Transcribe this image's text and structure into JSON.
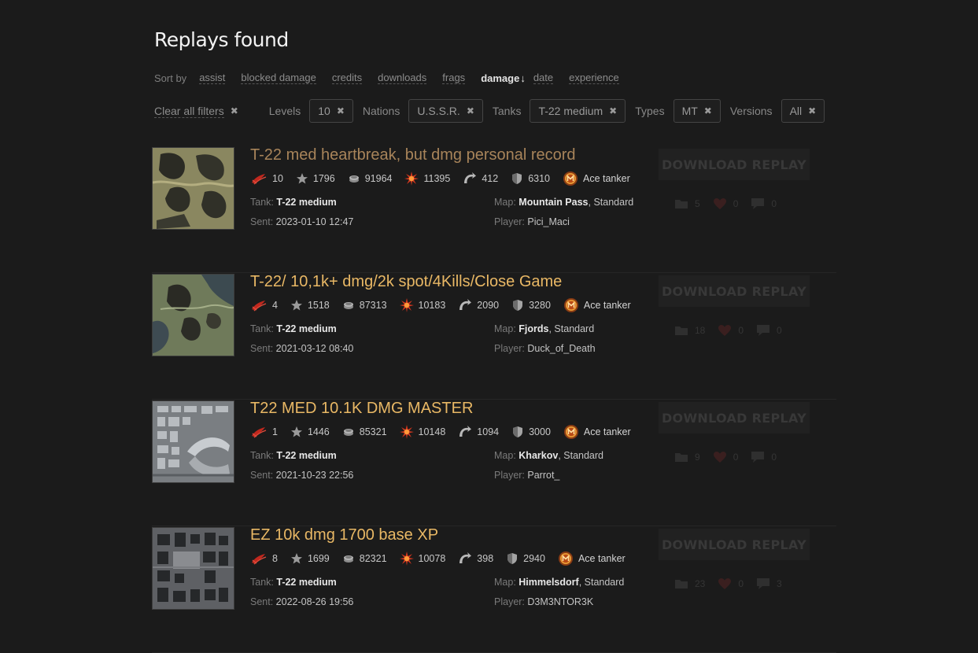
{
  "page": {
    "title": "Replays found"
  },
  "sort": {
    "prefix": "Sort by",
    "options": [
      {
        "label": "assist"
      },
      {
        "label": "blocked damage"
      },
      {
        "label": "credits"
      },
      {
        "label": "downloads"
      },
      {
        "label": "frags"
      },
      {
        "label": "damage",
        "active": true,
        "arrow": "↓"
      },
      {
        "label": "date"
      },
      {
        "label": "experience"
      }
    ]
  },
  "filters": {
    "clear_label": "Clear all filters",
    "remove_glyph": "✖",
    "groups": [
      {
        "label": "Levels",
        "value": "10"
      },
      {
        "label": "Nations",
        "value": "U.S.S.R."
      },
      {
        "label": "Tanks",
        "value": "T-22 medium"
      },
      {
        "label": "Types",
        "value": "MT"
      },
      {
        "label": "Versions",
        "value": "All"
      }
    ]
  },
  "labels": {
    "tank": "Tank:",
    "map": "Map:",
    "sent": "Sent:",
    "player": "Player:",
    "download": "DOWNLOAD REPLAY",
    "ace": "Ace tanker"
  },
  "replays": [
    {
      "title": "T-22 med heartbreak, but dmg personal record",
      "frags": "10",
      "spotted": "1796",
      "credits": "91964",
      "damage": "11395",
      "assist": "412",
      "blocked": "6310",
      "tank": "T-22 medium",
      "map": "Mountain Pass",
      "mode": ", Standard",
      "sent": "2023-01-10 12:47",
      "player": "Pici_Maci",
      "downloads": "5",
      "likes": "0",
      "comments": "0"
    },
    {
      "title": "T-22/ 10,1k+ dmg/2k spot/4Kills/Close Game",
      "frags": "4",
      "spotted": "1518",
      "credits": "87313",
      "damage": "10183",
      "assist": "2090",
      "blocked": "3280",
      "tank": "T-22 medium",
      "map": "Fjords",
      "mode": ", Standard",
      "sent": "2021-03-12 08:40",
      "player": "Duck_of_Death",
      "downloads": "18",
      "likes": "0",
      "comments": "0"
    },
    {
      "title": "T22 MED 10.1K DMG MASTER",
      "frags": "1",
      "spotted": "1446",
      "credits": "85321",
      "damage": "10148",
      "assist": "1094",
      "blocked": "3000",
      "tank": "T-22 medium",
      "map": "Kharkov",
      "mode": ", Standard",
      "sent": "2021-10-23 22:56",
      "player": "Parrot_",
      "downloads": "9",
      "likes": "0",
      "comments": "0"
    },
    {
      "title": "EZ 10k dmg 1700 base XP",
      "frags": "8",
      "spotted": "1699",
      "credits": "82321",
      "damage": "10078",
      "assist": "398",
      "blocked": "2940",
      "tank": "T-22 medium",
      "map": "Himmelsdorf",
      "mode": ", Standard",
      "sent": "2022-08-26 19:56",
      "player": "D3M3NTOR3K",
      "downloads": "23",
      "likes": "0",
      "comments": "3"
    }
  ]
}
